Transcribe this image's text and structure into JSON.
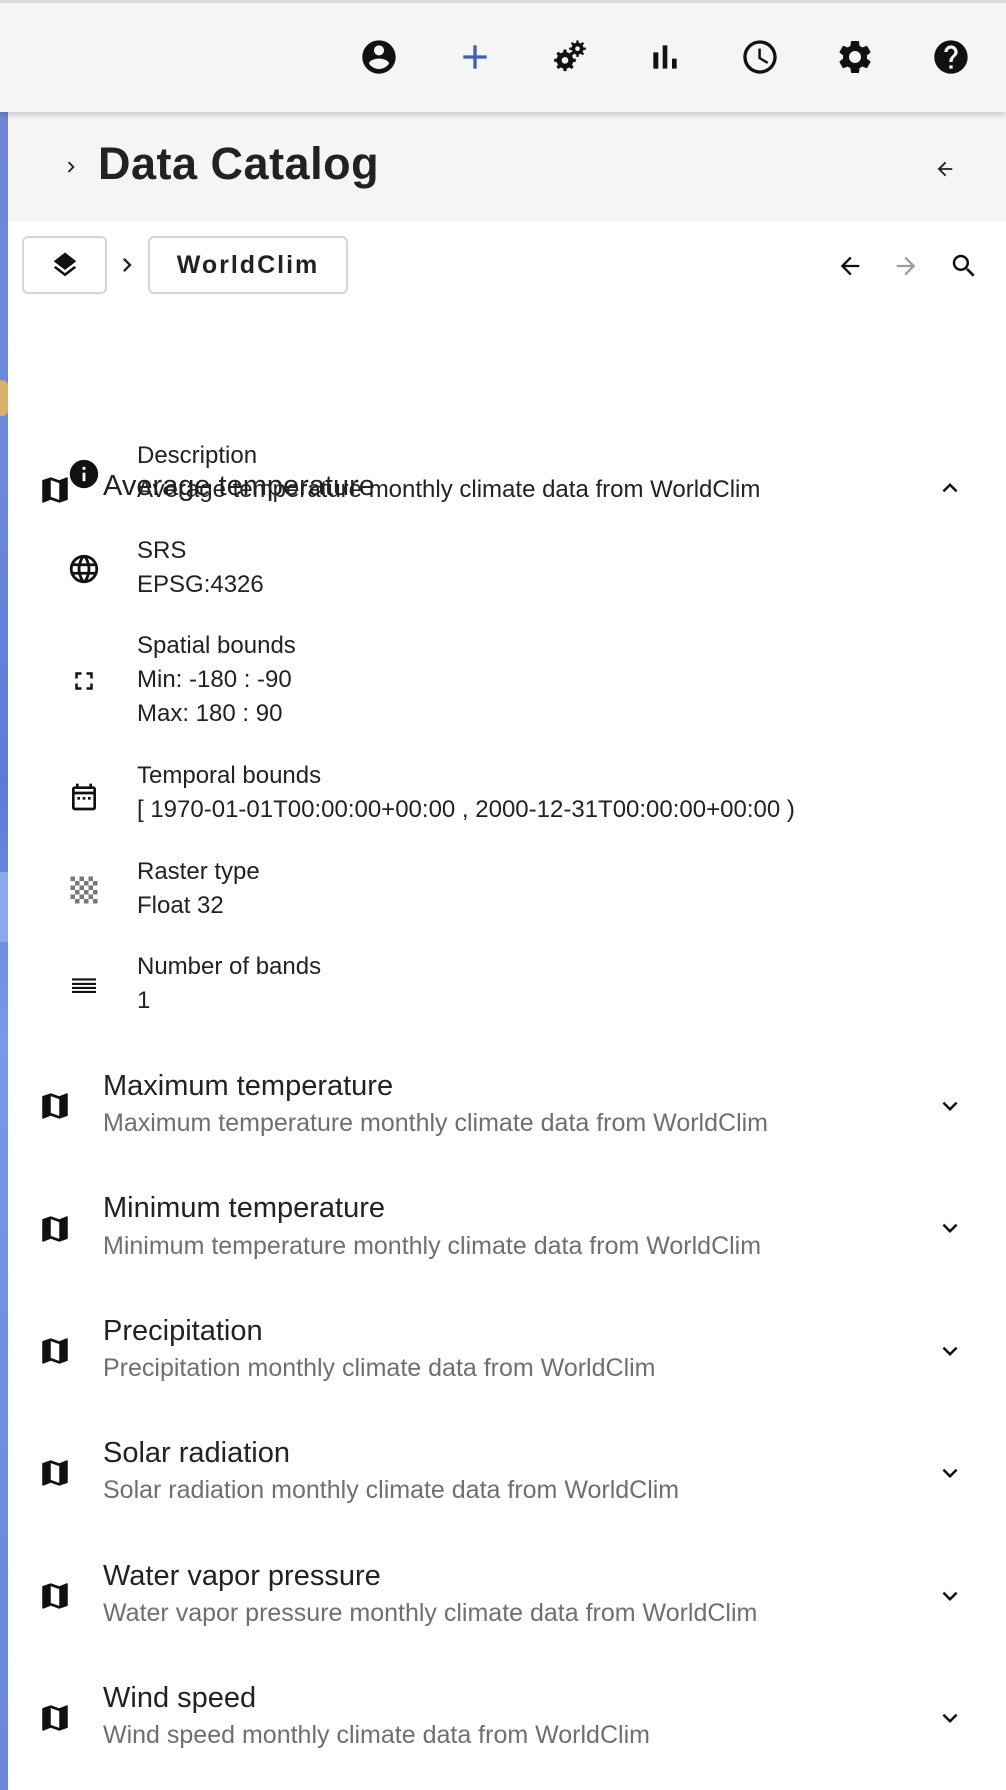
{
  "toolbar": {
    "icons": [
      "account-circle-icon",
      "add-icon",
      "gears-icon",
      "bar-chart-icon",
      "history-icon",
      "settings-icon",
      "help-icon"
    ],
    "accent_color": "#3f5fb5"
  },
  "panel": {
    "title": "Data Catalog"
  },
  "breadcrumb": {
    "current": "WorldClim"
  },
  "expanded_dataset": {
    "title": "Average temperature",
    "properties": [
      {
        "icon": "info-icon",
        "label": "Description",
        "values": [
          "Average temperature monthly climate data from WorldClim"
        ]
      },
      {
        "icon": "globe-icon",
        "label": "SRS",
        "values": [
          "EPSG:4326"
        ]
      },
      {
        "icon": "fullscreen-bounds-icon",
        "label": "Spatial bounds",
        "values": [
          "Min: -180 : -90",
          "Max: 180 : 90"
        ]
      },
      {
        "icon": "calendar-icon",
        "label": "Temporal bounds",
        "values": [
          "[ 1970-01-01T00:00:00+00:00 , 2000-12-31T00:00:00+00:00 )"
        ]
      },
      {
        "icon": "raster-checker-icon",
        "label": "Raster type",
        "values": [
          "Float 32"
        ]
      },
      {
        "icon": "bands-list-icon",
        "label": "Number of bands",
        "values": [
          "1"
        ]
      }
    ]
  },
  "datasets": [
    {
      "title": "Maximum temperature",
      "subtitle": "Maximum temperature monthly climate data from WorldClim"
    },
    {
      "title": "Minimum temperature",
      "subtitle": "Minimum temperature monthly climate data from WorldClim"
    },
    {
      "title": "Precipitation",
      "subtitle": "Precipitation monthly climate data from WorldClim"
    },
    {
      "title": "Solar radiation",
      "subtitle": "Solar radiation monthly climate data from WorldClim"
    },
    {
      "title": "Water vapor pressure",
      "subtitle": "Water vapor pressure monthly climate data from WorldClim"
    },
    {
      "title": "Wind speed",
      "subtitle": "Wind speed monthly climate data from WorldClim"
    }
  ]
}
